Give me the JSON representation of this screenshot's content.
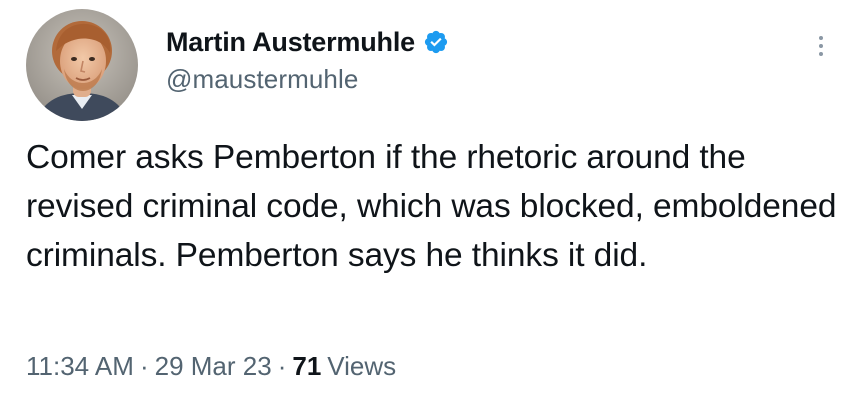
{
  "author": {
    "display_name": "Martin Austermuhle",
    "handle": "@maustermuhle",
    "verified": true
  },
  "tweet": {
    "text": "Comer asks Pemberton if the rhetoric around the revised criminal code, which was blocked, emboldened criminals. Pemberton says he thinks it did."
  },
  "meta": {
    "time": "11:34 AM",
    "separator": "·",
    "date": "29 Mar 23",
    "views_count": "71",
    "views_label": "Views"
  },
  "colors": {
    "verified_badge": "#1d9bf0",
    "secondary_text": "#536471",
    "primary_text": "#0f1419"
  },
  "icons": {
    "avatar": "profile-photo",
    "verified": "verified-badge-icon",
    "more": "more-vertical-icon"
  }
}
